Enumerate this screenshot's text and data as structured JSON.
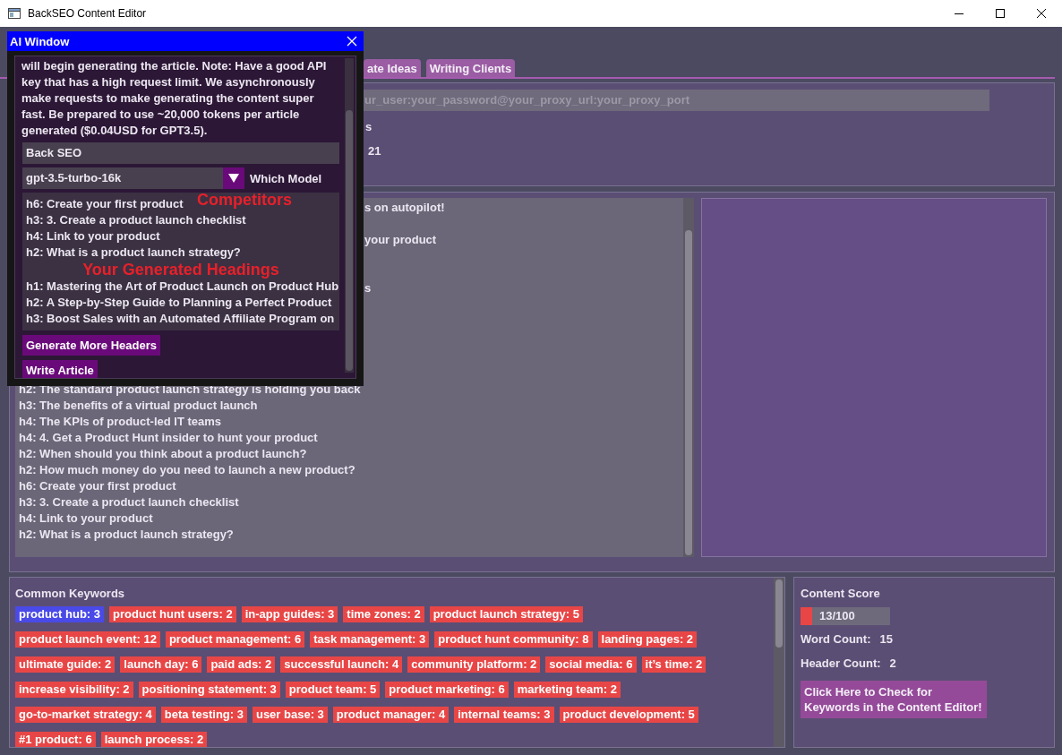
{
  "window": {
    "title": "BackSEO Content Editor"
  },
  "tabs": [
    {
      "label": "ate Ideas",
      "selected": false
    },
    {
      "label": "Writing Clients",
      "selected": false
    }
  ],
  "settings_panel": {
    "proxy_field": {
      "placeholder": "ur_user:your_password@your_proxy_url:your_proxy_port"
    },
    "label_fragment": "s",
    "results_value": "21"
  },
  "editor": {
    "fragments": [
      "s on autopilot!",
      "your product",
      "s"
    ],
    "lines": [
      "h2: The standard product launch strategy is holding you back",
      "h3: The benefits of a virtual product launch",
      "h4: The KPIs of product-led IT teams",
      "h4: 4. Get a Product Hunt insider to hunt your product",
      "h2: When should you think about a product launch?",
      "h2: How much money do you need to launch a new product?",
      "h6: Create your first product",
      "h3: 3. Create a product launch checklist",
      "h4: Link to your product",
      "h2: What is a product launch strategy?"
    ]
  },
  "ai_window": {
    "title": "AI Window",
    "description": "will begin generating the article. Note: Have a good API key that has a high request limit. We asynchronously make requests to make generating the content super fast. Be prepared to use ~20,000 tokens per article generated ($0.04USD for GPT3.5).",
    "project_field": {
      "value": "Back SEO"
    },
    "model_select": {
      "value": "gpt-3.5-turbo-16k",
      "label": "Which Model"
    },
    "competitors_caption": "Competitors",
    "competitor_headings": [
      "h6: Create your first product",
      "h3: 3. Create a product launch checklist",
      "h4: Link to your product",
      "h2: What is a product launch strategy?"
    ],
    "generated_caption": "Your Generated Headings",
    "generated_headings": [
      "h1: Mastering the Art of Product Launch on Product Hub",
      "h2: A Step-by-Step Guide to Planning a Perfect Product",
      "h3: Boost Sales with an Automated Affiliate Program on"
    ],
    "buttons": [
      "Generate More Headers",
      "Write Article"
    ]
  },
  "keywords": {
    "title": "Common Keywords",
    "items": [
      {
        "text": "product hub: 3",
        "selected": true
      },
      {
        "text": "product hunt users: 2",
        "selected": false
      },
      {
        "text": "in-app guides: 3",
        "selected": false
      },
      {
        "text": "time zones: 2",
        "selected": false
      },
      {
        "text": "product launch strategy: 5",
        "selected": false
      },
      {
        "text": "product launch event: 12",
        "selected": false
      },
      {
        "text": "product management: 6",
        "selected": false
      },
      {
        "text": "task management: 3",
        "selected": false
      },
      {
        "text": "product hunt community: 8",
        "selected": false
      },
      {
        "text": "landing pages: 2",
        "selected": false
      },
      {
        "text": "ultimate guide: 2",
        "selected": false
      },
      {
        "text": "launch day: 6",
        "selected": false
      },
      {
        "text": "paid ads: 2",
        "selected": false
      },
      {
        "text": "successful launch: 4",
        "selected": false
      },
      {
        "text": "community platform: 2",
        "selected": false
      },
      {
        "text": "social media: 6",
        "selected": false
      },
      {
        "text": "it’s time: 2",
        "selected": false
      },
      {
        "text": "increase visibility: 2",
        "selected": false
      },
      {
        "text": "positioning statement: 3",
        "selected": false
      },
      {
        "text": "product team: 5",
        "selected": false
      },
      {
        "text": "product marketing: 6",
        "selected": false
      },
      {
        "text": "marketing team: 2",
        "selected": false
      },
      {
        "text": "go-to-market strategy: 4",
        "selected": false
      },
      {
        "text": "beta testing: 3",
        "selected": false
      },
      {
        "text": "user base: 3",
        "selected": false
      },
      {
        "text": "product manager: 4",
        "selected": false
      },
      {
        "text": "internal teams: 3",
        "selected": false
      },
      {
        "text": "product development: 5",
        "selected": false
      },
      {
        "text": "#1 product: 6",
        "selected": false
      },
      {
        "text": "launch process: 2",
        "selected": false
      }
    ]
  },
  "score": {
    "title": "Content Score",
    "level": 0.13,
    "reading": "13/100",
    "stats": [
      {
        "label": "Word Count:",
        "value": "15"
      },
      {
        "label": "Header Count:",
        "value": "2"
      }
    ],
    "button": "Click Here to Check for Keywords in the Content Editor!"
  }
}
